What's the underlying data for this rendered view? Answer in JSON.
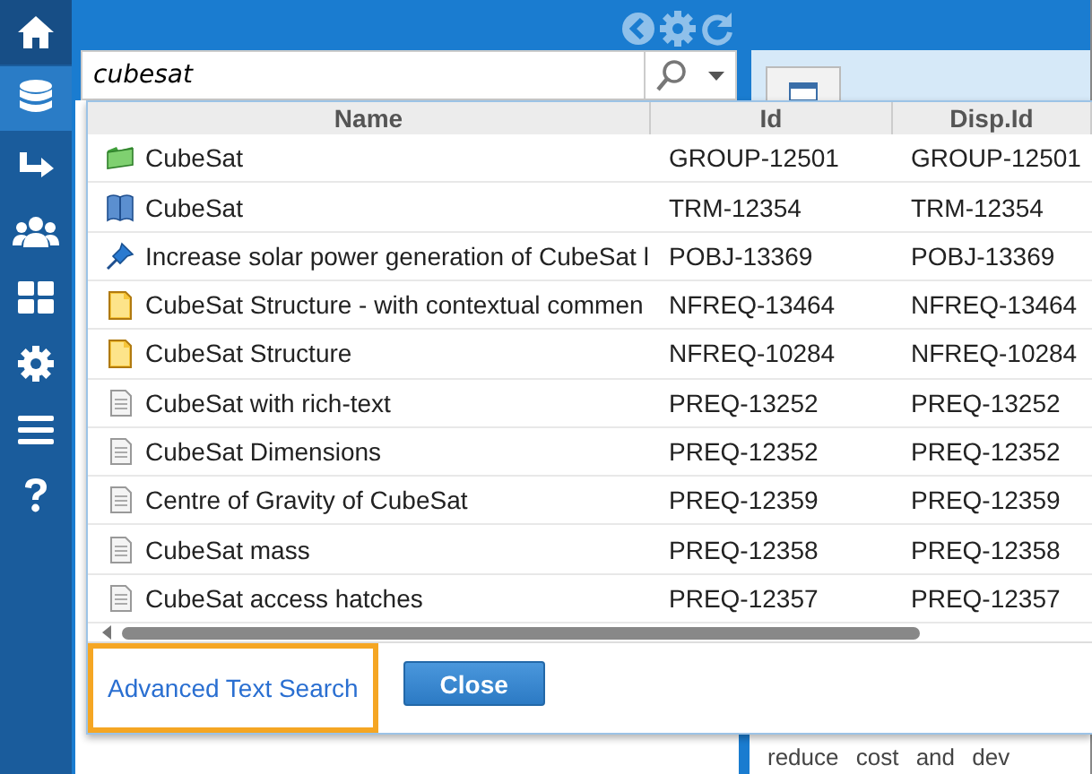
{
  "sidebar": {
    "items": [
      {
        "selected": false
      },
      {
        "selected": true
      },
      {
        "selected": false
      },
      {
        "selected": false
      },
      {
        "selected": false
      },
      {
        "selected": false
      },
      {
        "selected": false
      },
      {
        "selected": false
      }
    ]
  },
  "search": {
    "value": "cubesat"
  },
  "background": {
    "text": "reduce cost and dev"
  },
  "results": {
    "columns": [
      "Name",
      "Id",
      "Disp.Id"
    ],
    "rows": [
      {
        "kind": "group",
        "name": "CubeSat",
        "id": "GROUP-12501",
        "disp_id": "GROUP-12501"
      },
      {
        "kind": "term",
        "name": "CubeSat",
        "id": "TRM-12354",
        "disp_id": "TRM-12354"
      },
      {
        "kind": "objective",
        "name": "Increase solar power generation of CubeSat l",
        "id": "POBJ-13369",
        "disp_id": "POBJ-13369"
      },
      {
        "kind": "nfreq",
        "name": "CubeSat Structure - with contextual commen",
        "id": "NFREQ-13464",
        "disp_id": "NFREQ-13464"
      },
      {
        "kind": "nfreq",
        "name": "CubeSat Structure",
        "id": "NFREQ-10284",
        "disp_id": "NFREQ-10284"
      },
      {
        "kind": "preq",
        "name": "CubeSat with rich-text",
        "id": "PREQ-13252",
        "disp_id": "PREQ-13252"
      },
      {
        "kind": "preq",
        "name": "CubeSat Dimensions",
        "id": "PREQ-12352",
        "disp_id": "PREQ-12352"
      },
      {
        "kind": "preq",
        "name": "Centre of Gravity of CubeSat",
        "id": "PREQ-12359",
        "disp_id": "PREQ-12359"
      },
      {
        "kind": "preq",
        "name": "CubeSat mass",
        "id": "PREQ-12358",
        "disp_id": "PREQ-12358"
      },
      {
        "kind": "preq",
        "name": "CubeSat access hatches",
        "id": "PREQ-12357",
        "disp_id": "PREQ-12357"
      }
    ],
    "link": "Advanced Text Search",
    "close_button": "Close"
  }
}
